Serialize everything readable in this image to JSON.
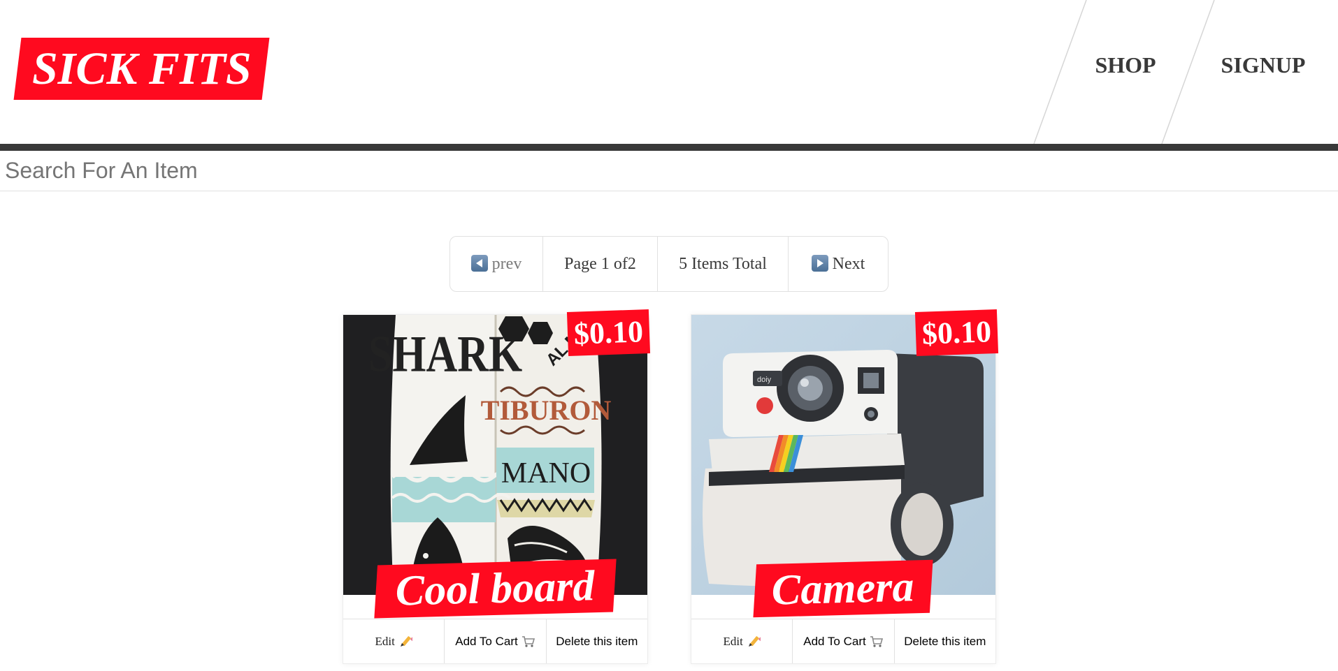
{
  "header": {
    "logo_text": "SICK FITS",
    "nav": [
      {
        "label": "SHOP"
      },
      {
        "label": "SIGNUP"
      }
    ],
    "accent_color": "#ff0a1f",
    "bar_color": "#393939"
  },
  "search": {
    "placeholder": "Search For An Item",
    "value": ""
  },
  "pagination": {
    "prev_label": "prev",
    "page_text": "Page 1 of2",
    "total_text": "5 Items Total",
    "next_label": "Next"
  },
  "products": [
    {
      "title": "Cool board",
      "price": "$0.10",
      "image": "shark-surfboard-image",
      "buttons": {
        "edit": "Edit",
        "add_to_cart": "Add To Cart",
        "delete": "Delete this item"
      }
    },
    {
      "title": "Camera",
      "price": "$0.10",
      "image": "polaroid-camera-toilet-roll-holder-image",
      "buttons": {
        "edit": "Edit",
        "add_to_cart": "Add To Cart",
        "delete": "Delete this item"
      }
    }
  ]
}
